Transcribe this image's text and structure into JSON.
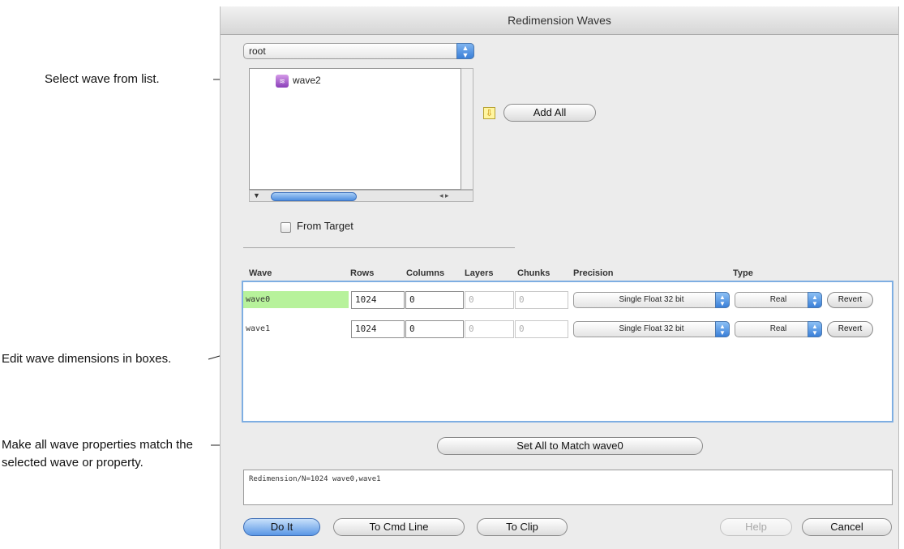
{
  "annotations": {
    "select_wave": "Select wave from list.",
    "edit_dimensions": "Edit wave dimensions in boxes.",
    "match_properties": "Make all wave properties match the selected wave or property."
  },
  "dialog": {
    "title": "Redimension Waves",
    "data_folder": "root",
    "wave_list": [
      "wave2"
    ],
    "add_all_label": "Add All",
    "from_target_label": "From Target",
    "from_target_checked": false
  },
  "table": {
    "headers": [
      "Wave",
      "Rows",
      "Columns",
      "Layers",
      "Chunks",
      "Precision",
      "Type"
    ],
    "rows": [
      {
        "wave": "wave0",
        "rows": "1024",
        "columns": "0",
        "layers": "0",
        "chunks": "0",
        "precision": "Single Float 32 bit",
        "type": "Real",
        "revert": "Revert",
        "selected": true
      },
      {
        "wave": "wave1",
        "rows": "1024",
        "columns": "0",
        "layers": "0",
        "chunks": "0",
        "precision": "Single Float 32 bit",
        "type": "Real",
        "revert": "Revert",
        "selected": false
      }
    ]
  },
  "set_all_label": "Set All to Match wave0",
  "command_text": "Redimension/N=1024 wave0,wave1",
  "buttons": {
    "do_it": "Do It",
    "to_cmd_line": "To Cmd Line",
    "to_clip": "To Clip",
    "help": "Help",
    "cancel": "Cancel"
  },
  "colors": {
    "selected_row": "#b7f29b",
    "table_border": "#7eaee2",
    "default_button": "#5a97e5"
  },
  "icons": {
    "wave": "wave-icon",
    "add_arrow": "down-arrow-icon",
    "popup": "popup-arrows-icon"
  }
}
